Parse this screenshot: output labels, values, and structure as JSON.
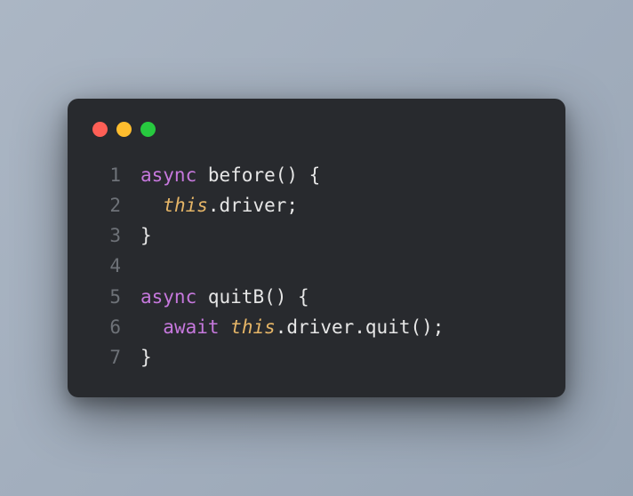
{
  "window": {
    "controls": [
      "close",
      "minimize",
      "maximize"
    ]
  },
  "code": {
    "lines": [
      {
        "no": "1"
      },
      {
        "no": "2"
      },
      {
        "no": "3"
      },
      {
        "no": "4"
      },
      {
        "no": "5"
      },
      {
        "no": "6"
      },
      {
        "no": "7"
      }
    ],
    "tokens": {
      "l1_async": "async",
      "l1_fn": "before",
      "l1_rest": "() {",
      "l2_indent": "  ",
      "l2_this": "this",
      "l2_rest": ".driver;",
      "l3": "}",
      "l4": "",
      "l5_async": "async",
      "l5_fn": "quitB",
      "l5_rest": "() {",
      "l6_indent": "  ",
      "l6_await": "await",
      "l6_this": "this",
      "l6_rest": ".driver.quit();",
      "l7": "}"
    }
  }
}
